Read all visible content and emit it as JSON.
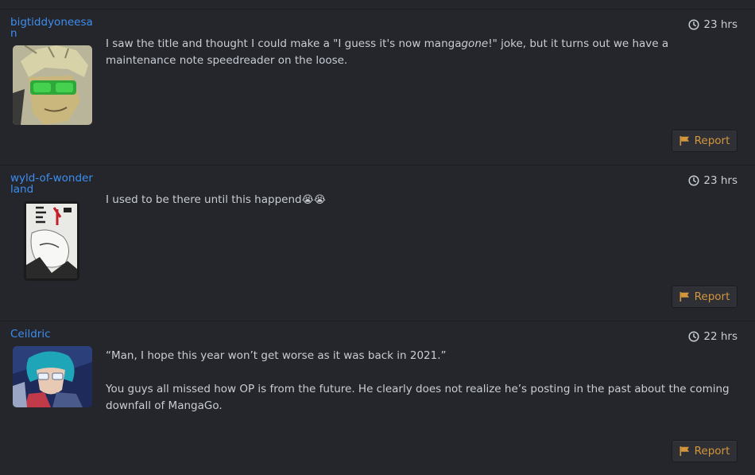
{
  "posts": [
    {
      "username": "bigtiddyoneesan",
      "time": "23 hrs",
      "paragraphs": [
        {
          "before": "I saw the title and thought I could make a \"I guess it's now manga",
          "em": "gone",
          "after": "!\" joke, but it turns out we have a maintenance note speedreader on the loose."
        }
      ],
      "report_label": "Report",
      "avatar": "avatar-sunglasses-man"
    },
    {
      "username": "wyld-of-wonderland",
      "time": "23 hrs",
      "text": "I used to be there until this happend",
      "emoji": "😭😭",
      "report_label": "Report",
      "avatar": "avatar-manga-cover"
    },
    {
      "username": "Ceildric",
      "time": "22 hrs",
      "paragraphs": [
        "“Man, I hope this year won’t get worse as it was back in 2021.”",
        "You guys all missed how OP is from the future. He clearly does not realize he’s posting in the past about the coming downfall of MangaGo."
      ],
      "report_label": "Report",
      "avatar": "avatar-teal-hair-pilot"
    }
  ],
  "colors": {
    "background": "#24262b",
    "username": "#3d8ef0",
    "report_text": "#d4963c",
    "body_text": "#c9cdd4"
  },
  "icons": {
    "time": "clock-icon",
    "report": "flag-icon"
  }
}
